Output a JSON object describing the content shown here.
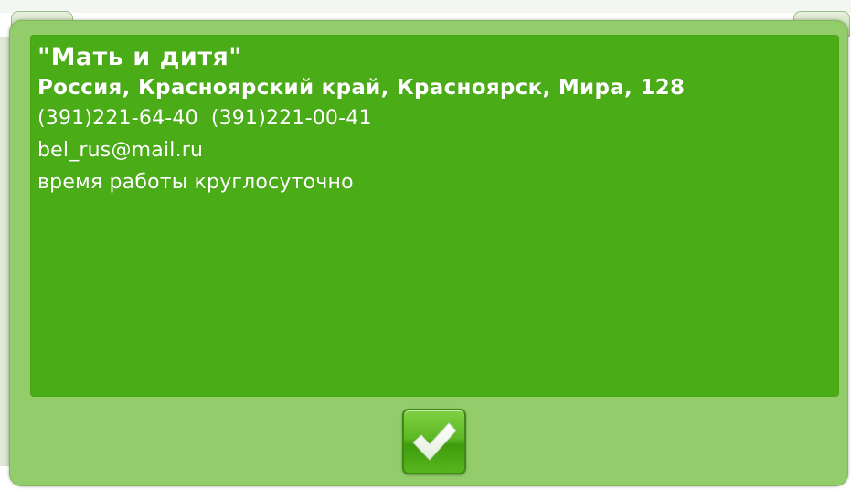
{
  "organization": {
    "name": "\"Мать и дитя\"",
    "address": "Россия, Красноярский край, Красноярск, Мира, 128",
    "phones": [
      "(391)221-64-40",
      "(391)221-00-41"
    ],
    "email": "bel_rus@mail.ru",
    "hours": "время работы круглосуточно"
  },
  "confirm_button": {
    "icon": "checkmark-icon"
  },
  "colors": {
    "dialog_bg": "#93cc6a",
    "panel_bg": "#4aac16",
    "text": "#ffffff",
    "button_green": "#5db823"
  }
}
